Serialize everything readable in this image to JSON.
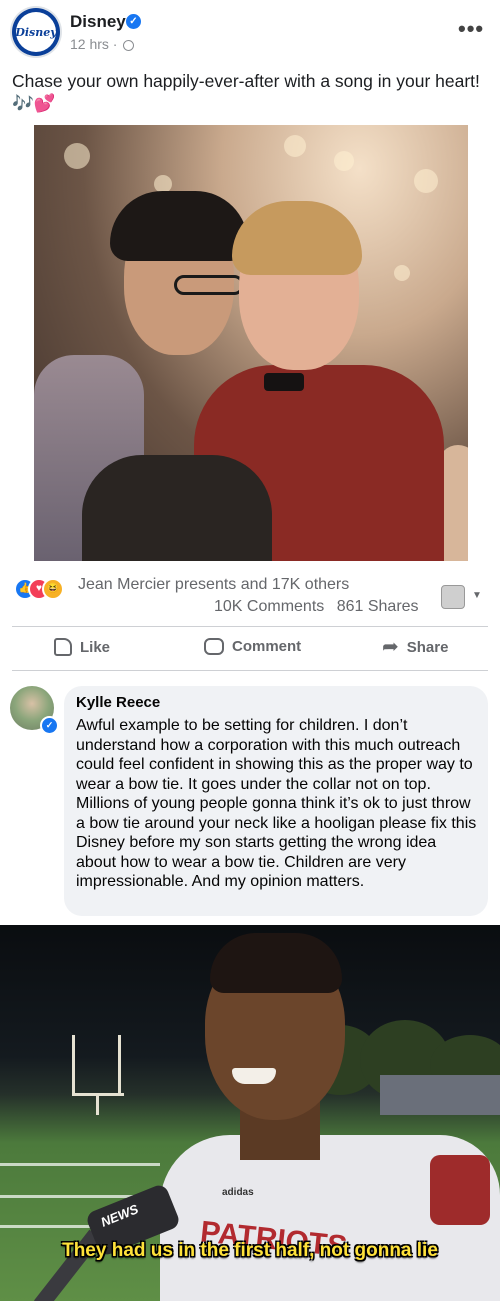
{
  "post": {
    "page_name": "Disney",
    "avatar_logo": "Disney",
    "time": "12 hrs ·",
    "caption": "Chase your own happily-ever-after with a song in your heart! 🎶💕"
  },
  "reactions": {
    "summary": "Jean Mercier presents and 17K others",
    "comments": "10K Comments",
    "shares": "861 Shares",
    "icons": [
      "like-icon",
      "love-icon",
      "haha-icon"
    ]
  },
  "actions": {
    "like": "Like",
    "comment": "Comment",
    "share": "Share"
  },
  "comment": {
    "author": "Kylle Reece",
    "text": "Awful example to be setting for children. I don’t understand how a corporation with this much outreach could feel confident in showing this as the proper way to wear a bow tie. It goes under the collar not on top. Millions of young people gonna think it’s ok to just throw a bow tie around your neck like a hooligan please fix this Disney before my son starts getting the wrong idea about how to wear a bow tie. Children are very impressionable. And my opinion matters."
  },
  "meme": {
    "subtitle": "They had us in the first half, not gonna lie",
    "mic_label": "NEWS",
    "jersey_text": "PATRIOTS",
    "brand": "adidas"
  },
  "colors": {
    "facebook_blue": "#1877f2",
    "disney_blue": "#0a3f99",
    "muted_text": "#65676b",
    "subtitle_yellow": "#ffe23a"
  }
}
